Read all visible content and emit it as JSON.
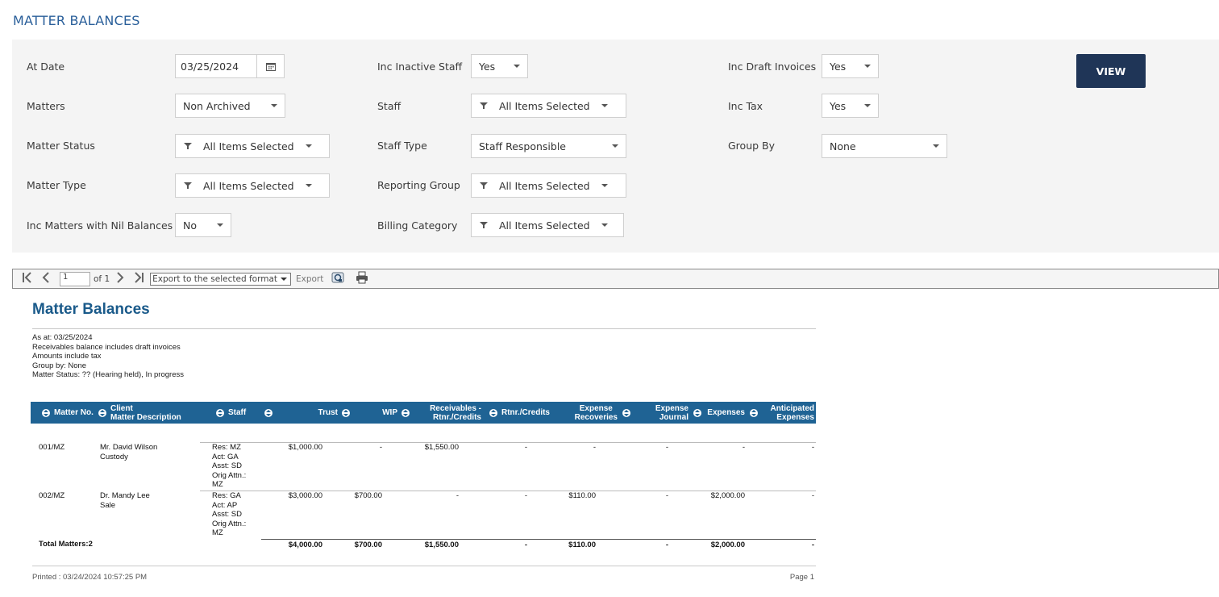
{
  "page": {
    "title": "MATTER BALANCES"
  },
  "filters": {
    "at_date": {
      "label": "At Date",
      "value": "03/25/2024"
    },
    "matters": {
      "label": "Matters",
      "value": "Non Archived"
    },
    "matter_status": {
      "label": "Matter Status",
      "value": "All Items Selected"
    },
    "matter_type": {
      "label": "Matter Type",
      "value": "All Items Selected"
    },
    "inc_nil": {
      "label": "Inc Matters with Nil Balances",
      "value": "No"
    },
    "inc_inactive_staff": {
      "label": "Inc Inactive Staff",
      "value": "Yes"
    },
    "staff": {
      "label": "Staff",
      "value": "All Items Selected"
    },
    "staff_type": {
      "label": "Staff Type",
      "value": "Staff Responsible"
    },
    "reporting_group": {
      "label": "Reporting Group",
      "value": "All Items Selected"
    },
    "billing_category": {
      "label": "Billing Category",
      "value": "All Items Selected"
    },
    "inc_draft_invoices": {
      "label": "Inc Draft Invoices",
      "value": "Yes"
    },
    "inc_tax": {
      "label": "Inc Tax",
      "value": "Yes"
    },
    "group_by": {
      "label": "Group By",
      "value": "None"
    },
    "view_button": "VIEW"
  },
  "toolbar": {
    "page_number": "1",
    "of_pages": "of 1",
    "export_format": "Export to the selected format",
    "export_label": "Export",
    "icons": [
      "first-page-icon",
      "prev-page-icon",
      "next-page-icon",
      "last-page-icon",
      "refresh-icon",
      "print-icon"
    ]
  },
  "report": {
    "title": "Matter Balances",
    "info": [
      "As at: 03/25/2024",
      "Receivables balance includes draft invoices",
      "Amounts include tax",
      "Group by: None",
      "Matter Status: ?? (Hearing held), In progress"
    ],
    "columns": {
      "matter_no": "Matter No.",
      "client": "Client",
      "matter_description": "Matter Description",
      "staff": "Staff",
      "trust": "Trust",
      "wip": "WIP",
      "receivables_1": "Receivables -",
      "receivables_2": "Rtnr./Credits",
      "rtnr_credits": "Rtnr./Credits",
      "exp_rec_1": "Expense",
      "exp_rec_2": "Recoveries",
      "exp_jrn_1": "Expense",
      "exp_jrn_2": "Journal",
      "expenses": "Expenses",
      "anticipated_1": "Anticipated",
      "anticipated_2": "Expenses"
    },
    "rows": [
      {
        "matter_no": "001/MZ",
        "client": "Mr. David Wilson",
        "description": "Custody",
        "staff": [
          "Res: MZ",
          "Act: GA",
          "Asst: SD",
          "Orig Attn.:",
          "MZ"
        ],
        "trust": "$1,000.00",
        "wip": "-",
        "receivables": "$1,550.00",
        "rtnr_credits": "-",
        "expense_recoveries": "-",
        "expense_journal": "-",
        "expenses": "-",
        "anticipated": "-"
      },
      {
        "matter_no": "002/MZ",
        "client": "Dr. Mandy Lee",
        "description": "Sale",
        "staff": [
          "Res: GA",
          "Act: AP",
          "Asst: SD",
          "Orig Attn.:",
          "MZ"
        ],
        "trust": "$3,000.00",
        "wip": "$700.00",
        "receivables": "-",
        "rtnr_credits": "-",
        "expense_recoveries": "$110.00",
        "expense_journal": "-",
        "expenses": "$2,000.00",
        "anticipated": "-"
      }
    ],
    "totals": {
      "label": "Total Matters:2",
      "trust": "$4,000.00",
      "wip": "$700.00",
      "receivables": "$1,550.00",
      "rtnr_credits": "-",
      "expense_recoveries": "$110.00",
      "expense_journal": "-",
      "expenses": "$2,000.00",
      "anticipated": "-"
    },
    "footer": {
      "printed": "Printed : 03/24/2024 10:57:25 PM",
      "page": "Page 1"
    }
  }
}
